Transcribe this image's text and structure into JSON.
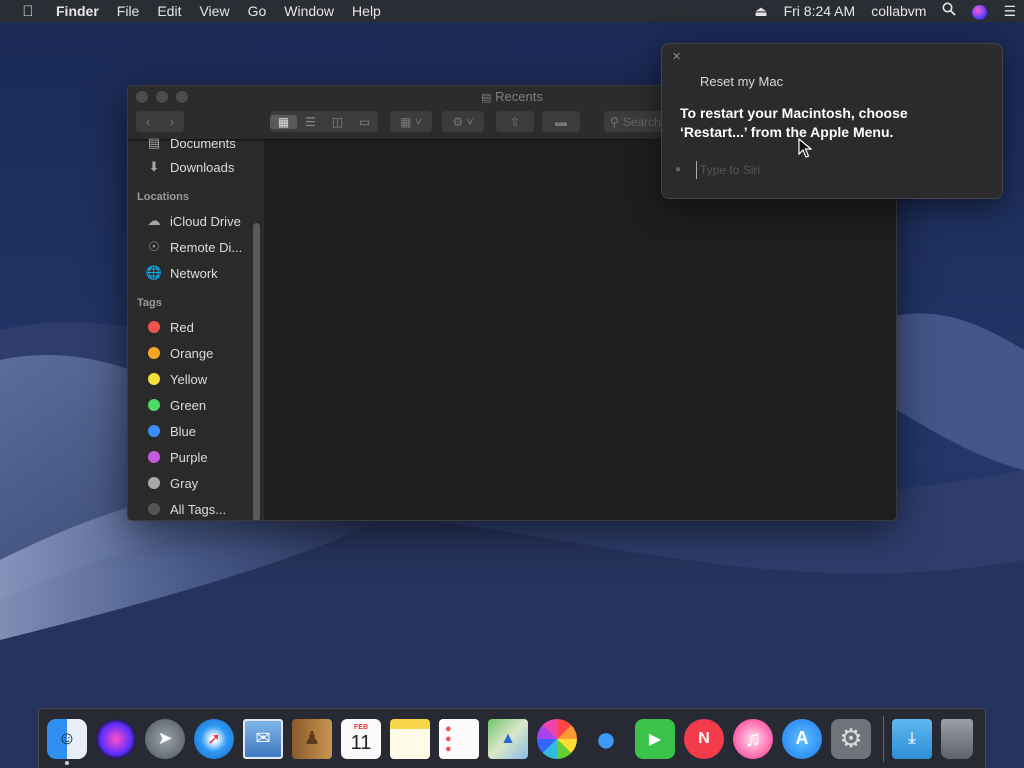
{
  "menubar": {
    "app_name": "Finder",
    "menus": [
      "File",
      "Edit",
      "View",
      "Go",
      "Window",
      "Help"
    ],
    "clock": "Fri 8:24 AM",
    "user": "collabvm"
  },
  "finder": {
    "title": "Recents",
    "search_placeholder": "Search",
    "sidebar": {
      "favorites": [
        {
          "label": "Documents",
          "icon": "documents-icon"
        },
        {
          "label": "Downloads",
          "icon": "downloads-icon"
        }
      ],
      "locations_header": "Locations",
      "locations": [
        {
          "label": "iCloud Drive",
          "icon": "cloud-icon"
        },
        {
          "label": "Remote Di...",
          "icon": "disc-icon"
        },
        {
          "label": "Network",
          "icon": "globe-icon"
        }
      ],
      "tags_header": "Tags",
      "tags": [
        {
          "label": "Red",
          "color": "#ef5350"
        },
        {
          "label": "Orange",
          "color": "#f5a623"
        },
        {
          "label": "Yellow",
          "color": "#f3e03b"
        },
        {
          "label": "Green",
          "color": "#4cd964"
        },
        {
          "label": "Blue",
          "color": "#3a8dff"
        },
        {
          "label": "Purple",
          "color": "#c45ae0"
        },
        {
          "label": "Gray",
          "color": "#a8a8a8"
        },
        {
          "label": "All Tags...",
          "color": "#555555"
        }
      ]
    }
  },
  "siri": {
    "heading": "Reset my Mac",
    "answer_line1": "To restart your Macintosh, choose",
    "answer_line2": "‘Restart...’ from the Apple Menu.",
    "input_placeholder": "Type to Siri"
  },
  "dock": {
    "apps": [
      "Finder",
      "Siri",
      "Launchpad",
      "Safari",
      "Mail",
      "Contacts",
      "Calendar",
      "Notes",
      "Reminders",
      "Maps",
      "Photos",
      "Messages",
      "FaceTime",
      "News",
      "iTunes",
      "App Store",
      "System Preferences"
    ],
    "calendar_month": "FEB",
    "calendar_day": "11",
    "extras": [
      "Downloads",
      "Trash"
    ]
  }
}
